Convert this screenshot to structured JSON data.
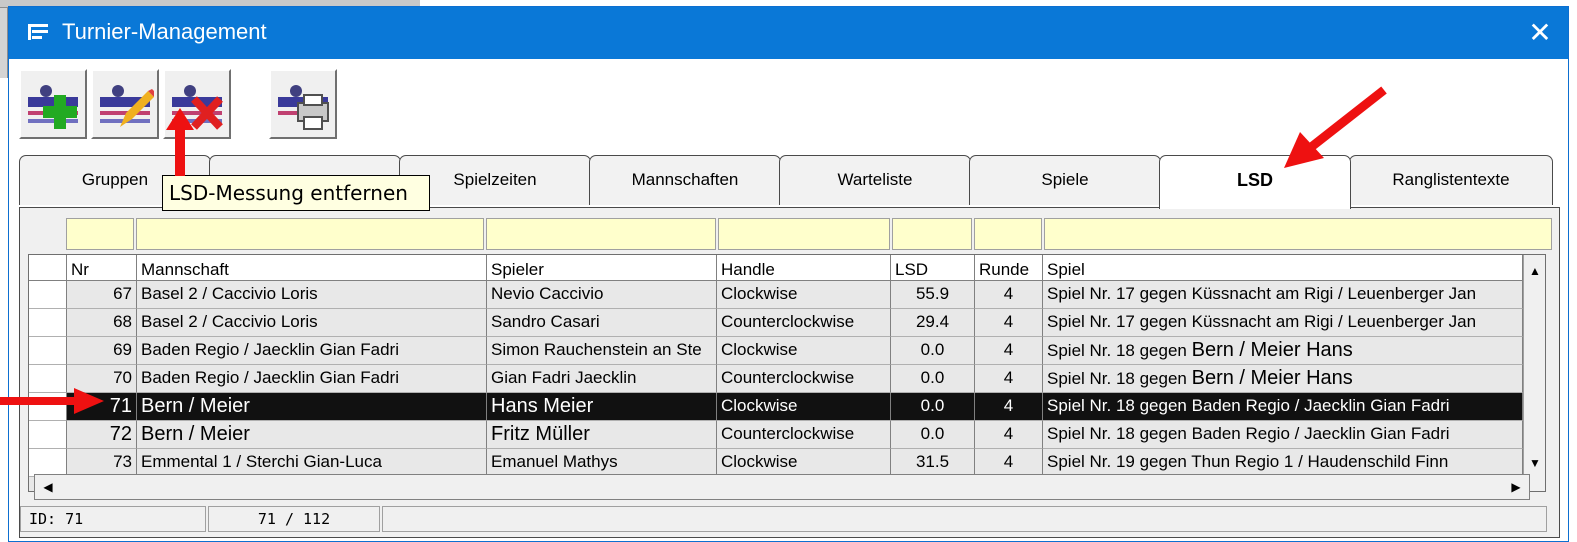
{
  "window": {
    "title": "Turnier-Management",
    "close_glyph": "✕"
  },
  "toolbar": {
    "buttons": [
      {
        "icon": "add-icon"
      },
      {
        "icon": "edit-icon"
      },
      {
        "icon": "delete-icon"
      },
      {
        "icon": "print-icon"
      }
    ]
  },
  "tooltip": {
    "text": "LSD-Messung entfernen"
  },
  "tabs": [
    {
      "label": "Gruppen"
    },
    {
      "label": ""
    },
    {
      "label": "Spielzeiten"
    },
    {
      "label": "Mannschaften"
    },
    {
      "label": "Warteliste"
    },
    {
      "label": "Spiele"
    },
    {
      "label": "LSD",
      "active": true
    },
    {
      "label": "Ranglistentexte"
    }
  ],
  "table": {
    "headers": [
      "Nr",
      "Mannschaft",
      "Spieler",
      "Handle",
      "LSD",
      "Runde",
      "Spiel"
    ],
    "rows": [
      {
        "nr": "67",
        "team": "Basel 2 / Caccivio Loris",
        "player": "Nevio Caccivio",
        "handle": "Clockwise",
        "lsd": "55.9",
        "round": "4",
        "game": "Spiel Nr. 17 gegen Küssnacht am Rigi / Leuenberger Jan"
      },
      {
        "nr": "68",
        "team": "Basel 2 / Caccivio Loris",
        "player": "Sandro Casari",
        "handle": "Counterclockwise",
        "lsd": "29.4",
        "round": "4",
        "game": "Spiel Nr. 17 gegen Küssnacht am Rigi / Leuenberger Jan"
      },
      {
        "nr": "69",
        "team": "Baden Regio / Jaecklin Gian Fadri",
        "player": "Simon Rauchenstein an Ste",
        "handle": "Clockwise",
        "lsd": "0.0",
        "round": "4",
        "game": "Spiel Nr. 18 gegen ",
        "game_big": "Bern / Meier Hans"
      },
      {
        "nr": "70",
        "team": "Baden Regio / Jaecklin Gian Fadri",
        "player": "Gian Fadri Jaecklin",
        "handle": "Counterclockwise",
        "lsd": "0.0",
        "round": "4",
        "game": "Spiel Nr. 18 gegen ",
        "game_big": "Bern / Meier Hans"
      },
      {
        "nr": "71",
        "team": "Bern / Meier",
        "player": "Hans Meier",
        "handle": "Clockwise",
        "lsd": "0.0",
        "round": "4",
        "game": "Spiel Nr. 18 gegen Baden Regio / Jaecklin Gian Fadri",
        "selected": true
      },
      {
        "nr": "72",
        "team": "Bern / Meier",
        "player": "Fritz Müller",
        "handle": "Counterclockwise",
        "lsd": "0.0",
        "round": "4",
        "game": "Spiel Nr. 18 gegen Baden Regio / Jaecklin Gian Fadri"
      },
      {
        "nr": "73",
        "team": "Emmental 1 / Sterchi Gian-Luca",
        "player": "Emanuel Mathys",
        "handle": "Clockwise",
        "lsd": "31.5",
        "round": "4",
        "game": "Spiel Nr. 19 gegen Thun Regio 1 / Haudenschild Finn"
      }
    ]
  },
  "status": {
    "id": "ID: 71",
    "position": "71 / 112",
    "extra": ""
  },
  "colors": {
    "titlebar": "#0a78d7",
    "filter": "#ffffcc",
    "selected_row": "#111111",
    "arrow": "#ee1111"
  }
}
